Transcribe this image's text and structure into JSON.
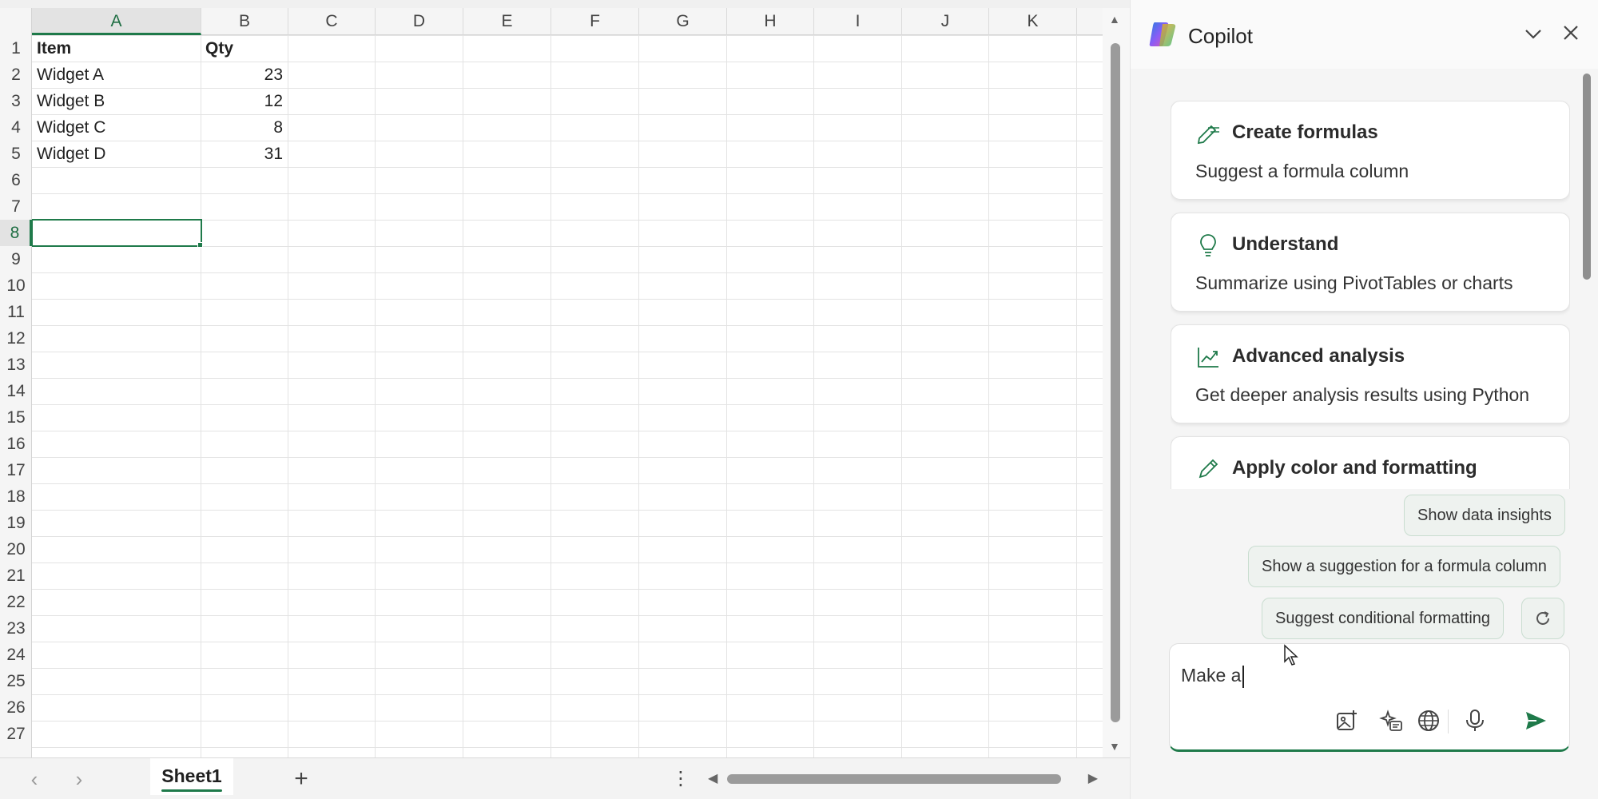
{
  "spreadsheet": {
    "columns": [
      "A",
      "B",
      "C",
      "D",
      "E",
      "F",
      "G",
      "H",
      "I",
      "J",
      "K"
    ],
    "active_column": "A",
    "rows": [
      "1",
      "2",
      "3",
      "4",
      "5",
      "6",
      "7",
      "8",
      "9",
      "10",
      "11",
      "12",
      "13",
      "14",
      "15",
      "16",
      "17",
      "18",
      "19",
      "20",
      "21",
      "22",
      "23",
      "24",
      "25",
      "26",
      "27"
    ],
    "active_row": "8",
    "header_row": {
      "item": "Item",
      "qty": "Qty"
    },
    "data_rows": [
      {
        "item": "Widget A",
        "qty": "23"
      },
      {
        "item": "Widget B",
        "qty": "12"
      },
      {
        "item": "Widget C",
        "qty": "8"
      },
      {
        "item": "Widget D",
        "qty": "31"
      }
    ],
    "selected_cell": "A8"
  },
  "sheet_tabs": {
    "tabs": [
      "Sheet1"
    ],
    "active": "Sheet1",
    "add_label": "+",
    "more_label": "⋮"
  },
  "copilot": {
    "title": "Copilot",
    "cards": [
      {
        "icon": "formula-pen-icon",
        "title": "Create formulas",
        "description": "Suggest a formula column"
      },
      {
        "icon": "lightbulb-icon",
        "title": "Understand",
        "description": "Summarize using PivotTables or charts"
      },
      {
        "icon": "chart-trend-icon",
        "title": "Advanced analysis",
        "description": "Get deeper analysis results using Python"
      },
      {
        "icon": "pencil-icon",
        "title": "Apply color and formatting",
        "description": ""
      }
    ],
    "suggestions": [
      "Show data insights",
      "Show a suggestion for a formula column",
      "Suggest conditional formatting"
    ],
    "composer": {
      "value": "Make a",
      "icons": [
        "image-add-icon",
        "sparkle-prompt-icon",
        "globe-icon",
        "microphone-icon",
        "send-icon"
      ]
    }
  },
  "colors": {
    "accent": "#1f7a4a",
    "chip_bg": "#eef2ef",
    "chip_border": "#c9ddd0"
  }
}
